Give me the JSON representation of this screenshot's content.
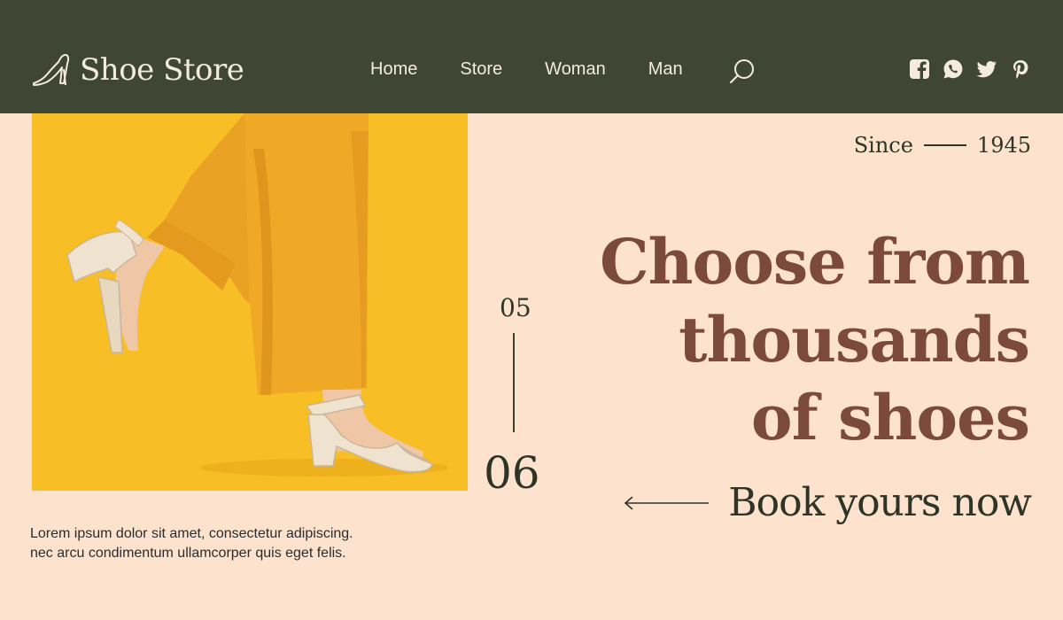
{
  "brand": {
    "name": "Shoe Store",
    "logo_icon": "high-heel-icon"
  },
  "nav": {
    "items": [
      {
        "label": "Home"
      },
      {
        "label": "Store"
      },
      {
        "label": "Woman"
      },
      {
        "label": "Man"
      }
    ],
    "search_icon": "search-icon"
  },
  "socials": [
    "facebook-icon",
    "whatsapp-icon",
    "twitter-icon",
    "pinterest-icon"
  ],
  "hero": {
    "since_label": "Since",
    "since_year": "1945",
    "headline": [
      "Choose from",
      "thousands",
      "of shoes"
    ],
    "cta_label": "Book yours now",
    "slide_current": "05",
    "slide_total": "06",
    "body_lines": [
      "Lorem ipsum dolor sit amet, consectetur adipiscing.",
      "nec arcu condimentum ullamcorper quis eget felis."
    ]
  },
  "colors": {
    "header_bg": "#3f4634",
    "page_bg": "#fde3cd",
    "headline": "#7b4a3b",
    "hero_yellow": "#f8be26",
    "pants_orange": "#eaa224"
  }
}
